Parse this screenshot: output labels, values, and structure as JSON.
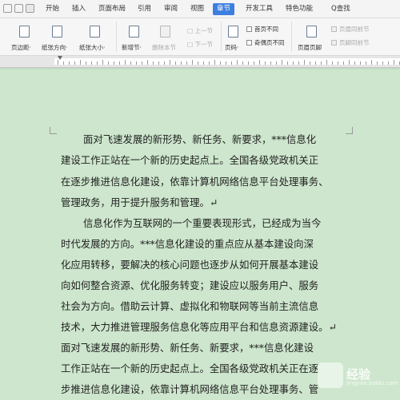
{
  "menubar": {
    "tabs": [
      "开始",
      "插入",
      "页面布局",
      "引用",
      "审阅",
      "视图",
      "章节",
      "开发工具",
      "特色功能"
    ],
    "active_tab": "章节",
    "search_label": "Q查找"
  },
  "toolbar": {
    "page_margin": "页边距·",
    "paper_orientation": "纸张方向·",
    "paper_size": "纸张大小·",
    "new_section": "新增节·",
    "delete_section": "删除本节",
    "prev_section": "上一节",
    "next_section": "下一节",
    "page_number": "页码·",
    "first_page_different": "首页不同",
    "odd_even_different": "奇偶页不同",
    "header_footer": "页眉页脚",
    "header_same_prev": "页眉同前节",
    "footer_same_prev": "页脚同前节"
  },
  "document": {
    "lines": [
      "面对飞速发展的新形势、新任务、新要求，***信息化",
      "建设工作正站在一个新的历史起点上。全国各级党政机关正",
      "在逐步推进信息化建设，依靠计算机网络信息平台处理事务、",
      "管理政务，用于提升服务和管理。↵",
      "信息化作为互联网的一个重要表现形式，已经成为当今",
      "时代发展的方向。***信息化建设的重点应从基本建设向深",
      "化应用转移，要解决的核心问题也逐步从如何开展基本建设",
      "向如何整合资源、优化服务转变；建设应以服务用户、服务",
      "社会为方向。借助云计算、虚拟化和物联网等当前主流信息",
      "技术，大力推进管理服务信息化等应用平台和信息资源建设。↵",
      "面对飞速发展的新形势、新任务、新要求，***信息化建设",
      "工作正站在一个新的历史起点上。全国各级党政机关正在逐",
      "步推进信息化建设，依靠计算机网络信息平台处理事务、管"
    ]
  },
  "watermark": {
    "text": "经验",
    "sub": "jingyan.baidu.com"
  },
  "colors": {
    "accent": "#3d7fe0",
    "page_background": "#cde6cd"
  }
}
